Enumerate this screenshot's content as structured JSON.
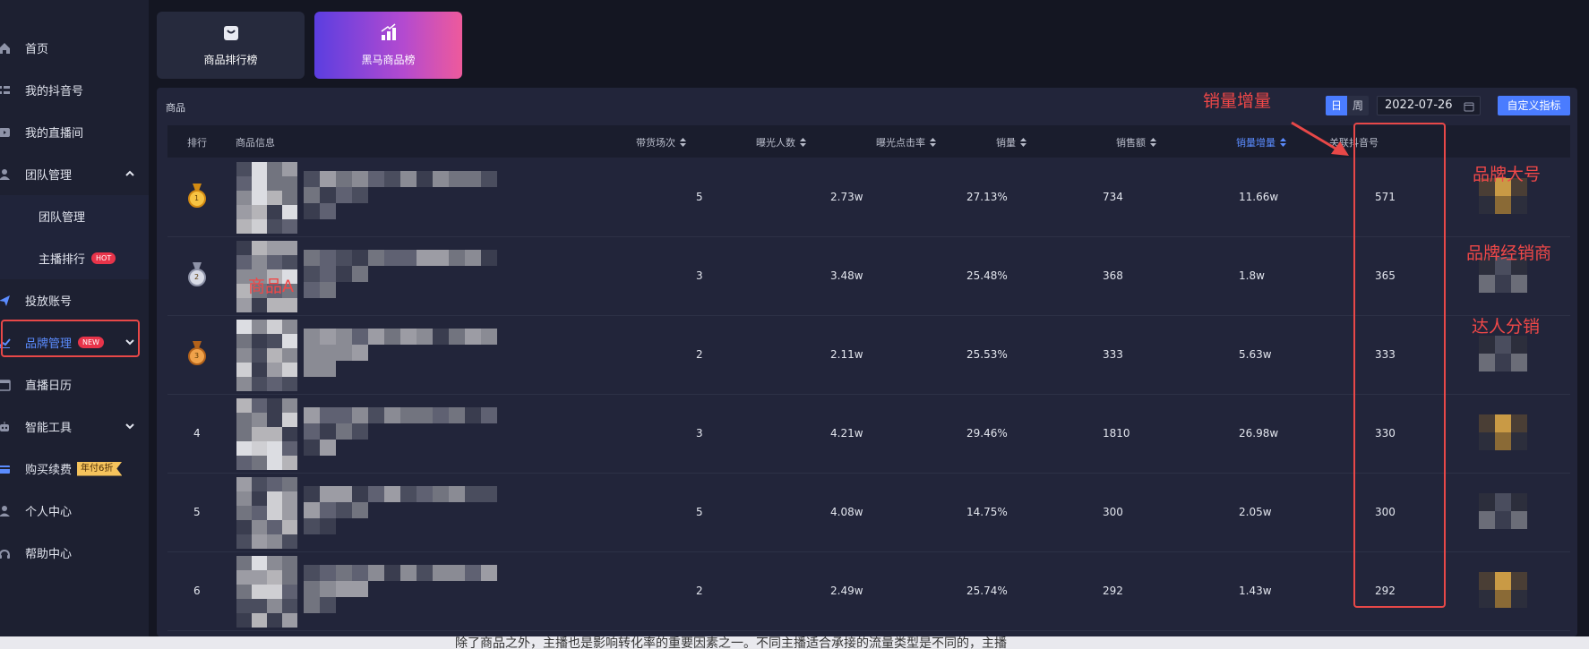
{
  "sidebar": {
    "items": [
      {
        "label": "首页",
        "icon": "home-icon"
      },
      {
        "label": "我的抖音号",
        "icon": "list-icon"
      },
      {
        "label": "我的直播间",
        "icon": "video-icon"
      },
      {
        "label": "团队管理",
        "icon": "team-icon"
      },
      {
        "label": "团队管理",
        "sub": true
      },
      {
        "label": "主播排行",
        "sub": true,
        "badge": "HOT"
      },
      {
        "label": "投放账号",
        "icon": "send-icon"
      },
      {
        "label": "品牌管理",
        "icon": "chart-icon",
        "badge": "NEW",
        "active": true
      },
      {
        "label": "直播日历",
        "icon": "calendar-icon"
      },
      {
        "label": "智能工具",
        "icon": "robot-icon"
      },
      {
        "label": "购买续费",
        "icon": "card-icon",
        "badge": "年付6折"
      },
      {
        "label": "个人中心",
        "icon": "user-icon"
      },
      {
        "label": "帮助中心",
        "icon": "help-icon"
      }
    ]
  },
  "tabs": [
    {
      "label": "商品排行榜",
      "icon": "bag-icon"
    },
    {
      "label": "黑马商品榜",
      "icon": "bar-up-icon"
    }
  ],
  "panel": {
    "title": "商品",
    "toggle_day": "日",
    "toggle_week": "周",
    "date": "2022-07-26",
    "custom_button": "自定义指标"
  },
  "table": {
    "headers": {
      "rank": "排行",
      "info": "商品信息",
      "sessions": "带货场次",
      "exposure": "曝光人数",
      "ctr": "曝光点击率",
      "sales": "销量",
      "revenue": "销售额",
      "increment": "销量增量",
      "account": "关联抖音号"
    },
    "rows": [
      {
        "rank": "1",
        "sessions": "5",
        "exposure": "2.73w",
        "ctr": "27.13%",
        "sales": "734",
        "revenue": "11.66w",
        "increment": "571"
      },
      {
        "rank": "2",
        "sessions": "3",
        "exposure": "3.48w",
        "ctr": "25.48%",
        "sales": "368",
        "revenue": "1.8w",
        "increment": "365"
      },
      {
        "rank": "3",
        "sessions": "2",
        "exposure": "2.11w",
        "ctr": "25.53%",
        "sales": "333",
        "revenue": "5.63w",
        "increment": "333"
      },
      {
        "rank": "4",
        "sessions": "3",
        "exposure": "4.21w",
        "ctr": "29.46%",
        "sales": "1810",
        "revenue": "26.98w",
        "increment": "330"
      },
      {
        "rank": "5",
        "sessions": "5",
        "exposure": "4.08w",
        "ctr": "14.75%",
        "sales": "300",
        "revenue": "2.05w",
        "increment": "300"
      },
      {
        "rank": "6",
        "sessions": "2",
        "exposure": "2.49w",
        "ctr": "25.74%",
        "sales": "292",
        "revenue": "1.43w",
        "increment": "292"
      }
    ]
  },
  "annotations": {
    "increment": "销量增量",
    "product_a": "商品A",
    "brand_big": "品牌大号",
    "brand_dealer": "品牌经销商",
    "influencer": "达人分销"
  },
  "bottom_text": "除了商品之外，主播也是影响转化率的重要因素之一。不同主播适合承接的流量类型是不同的，主播",
  "colors": {
    "accent": "#4a7cff",
    "annotation": "#e84848",
    "background": "#141622",
    "panel": "#22253a"
  }
}
